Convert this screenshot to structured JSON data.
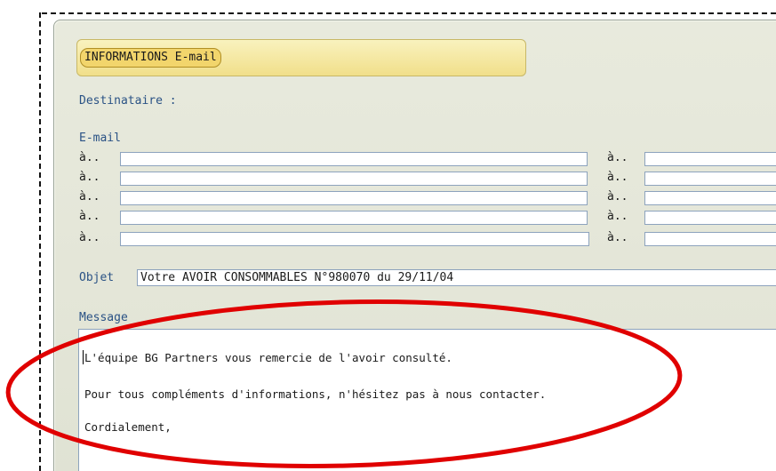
{
  "header": {
    "title": "INFORMATIONS E-mail"
  },
  "recipients": {
    "section_label": "Destinataire :",
    "email_label": "E-mail",
    "row_prefix": "à..",
    "rows": [
      {
        "left_value": "",
        "right_value": ""
      },
      {
        "left_value": "",
        "right_value": ""
      },
      {
        "left_value": "",
        "right_value": ""
      },
      {
        "left_value": "",
        "right_value": ""
      },
      {
        "left_value": "",
        "right_value": ""
      }
    ]
  },
  "subject": {
    "label": "Objet",
    "value": "Votre AVOIR CONSOMMABLES N°980070 du 29/11/04"
  },
  "message": {
    "label": "Message",
    "lines": [
      "L'équipe BG Partners vous remercie de l'avoir consulté.",
      "Pour tous compléments d'informations, n'hésitez pas à nous contacter.",
      "Cordialement,"
    ]
  },
  "colors": {
    "label_blue": "#2a5285",
    "title_yellow": "#f2d56c",
    "annotation_red": "#e00000",
    "panel_bg": "#e6e8da"
  }
}
